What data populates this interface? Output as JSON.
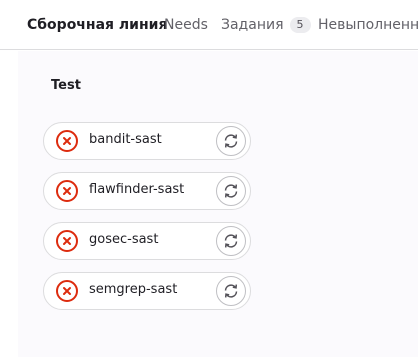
{
  "tabs": [
    {
      "label": "Сборочная линия",
      "active": true
    },
    {
      "label": "Needs"
    },
    {
      "label": "Задания",
      "count": "5"
    },
    {
      "label": "Невыполненн"
    }
  ],
  "stage": {
    "title": "Test",
    "jobs": [
      {
        "name": "bandit-sast",
        "status": "failed"
      },
      {
        "name": "flawfinder-sast",
        "status": "failed"
      },
      {
        "name": "gosec-sast",
        "status": "failed"
      },
      {
        "name": "semgrep-sast",
        "status": "failed"
      }
    ]
  },
  "icons": {
    "status": "status-failed-icon",
    "retry": "retry-icon"
  },
  "colors": {
    "failed": "#dd2b0e",
    "tab_underline": "#1f75cb",
    "panel_bg": "#fbfafd"
  }
}
